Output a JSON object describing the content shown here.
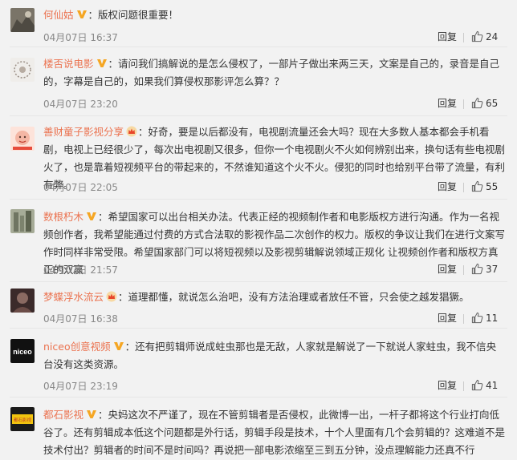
{
  "comments": [
    {
      "user": "何仙姑",
      "colon": "：",
      "text": "版权问题很重要！",
      "time": "04月07日 16:37",
      "reply_label": "回复",
      "likes": "24",
      "badge": "yellow-v",
      "avatar_color": "#7a7468"
    },
    {
      "user": "楼否说电影",
      "colon": "：",
      "text": "请问我们搞解说的是怎么侵权了，一部片子做出来两三天，文案是自己的，录音是自己的，字幕是自己的，如果我们算侵权那影评怎么算？？",
      "time": "04月07日 23:20",
      "reply_label": "回复",
      "likes": "65",
      "badge": "yellow-v",
      "avatar_color": "#e8e6e2"
    },
    {
      "user": "善财童子影视分享",
      "colon": "：",
      "text": "好奇，要是以后都没有，电视剧流量还会大吗？现在大多数人基本都会手机看剧，电视上已经很少了，每次出电视剧又很多，但你一个电视剧火不火如何辨别出来，换句话有些电视剧火了，也是靠着短视频平台的带起来的，不然谁知道这个火不火。侵犯的同时也给别平台带了流量，有利有弊。",
      "time": "04月07日 22:05",
      "reply_label": "回复",
      "likes": "55",
      "badge": "crown",
      "avatar_color": "#f4b6a4"
    },
    {
      "user": "数根朽木",
      "colon": "：",
      "text": "希望国家可以出台相关办法。代表正经的视频制作者和电影版权方进行沟通。作为一名视频创作者，我希望能通过付费的方式合法取的影视作品二次创作的权力。版权的争议让我们在进行文案写作时同样非常受限。希望国家部门可以将短视频以及影视剪辑解说领域正规化 让视频创作者和版权方真正的双赢",
      "time": "04月07日 21:57",
      "reply_label": "回复",
      "likes": "37",
      "badge": "yellow-v",
      "avatar_color": "#6f7562"
    },
    {
      "user": "梦蝶浮水流云",
      "colon": "：",
      "text": "道理都懂，就说怎么治吧，没有方法治理或者放任不管，只会使之越发猖獗。",
      "time": "04月07日 16:38",
      "reply_label": "回复",
      "likes": "11",
      "badge": "crown",
      "avatar_color": "#5a3f3c"
    },
    {
      "user": "niceo创意视频",
      "colon": "：",
      "text": "还有把剪辑师说成蛀虫那也是无敌，人家就是解说了一下就说人家蛀虫，我不信央台没有这类资源。",
      "time": "04月07日 23:19",
      "reply_label": "回复",
      "likes": "41",
      "badge": "yellow-v",
      "avatar_color": "#111111",
      "avatar_text": "niceo"
    },
    {
      "user": "都石影视",
      "colon": "：",
      "text": "央妈这次不严谨了，现在不管剪辑者是否侵权，此微博一出，一杆子都将这个行业打向低谷了。还有剪辑成本低这个问题都是外行话，剪辑手段是技术，十个人里面有几个会剪辑的？这难道不是技术付出？剪辑者的时间不是时间吗？再说把一部电影浓缩至三到五分钟，没点理解能力还真不行",
      "time": "",
      "reply_label": "",
      "likes": "",
      "badge": "yellow-v",
      "avatar_color": "#1a1a1a",
      "avatar_text": "都石影视"
    }
  ],
  "colors": {
    "username": "#eb7350",
    "text": "#333333",
    "meta": "#888888",
    "background": "#f2f2f2",
    "badge_v": "#f5a623"
  },
  "icons": {
    "like": "thumbs-up-icon",
    "verified": "verified-v-icon",
    "member": "crown-icon"
  }
}
